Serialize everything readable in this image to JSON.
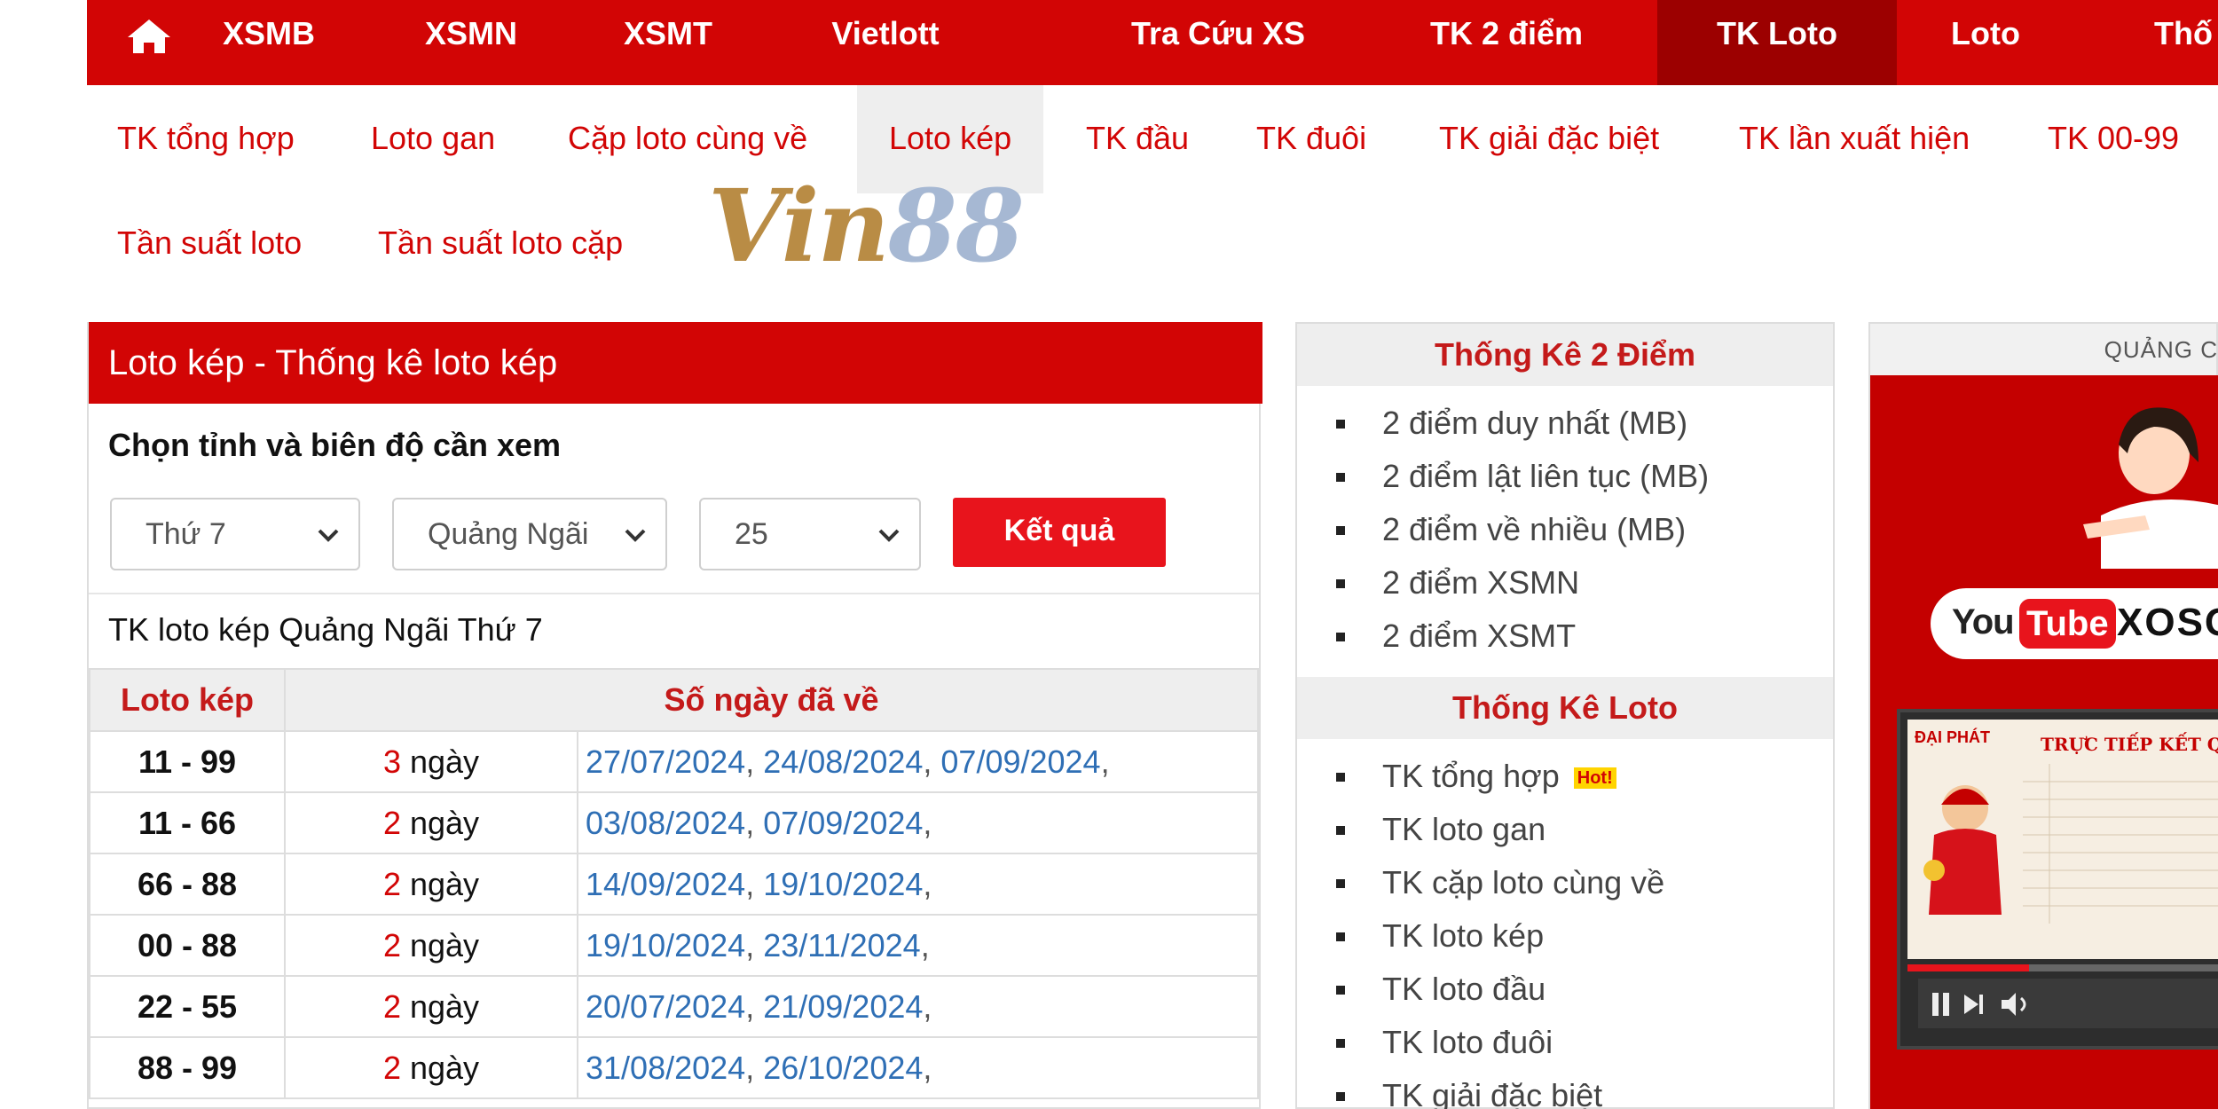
{
  "topnav": {
    "home_icon": "home-icon",
    "items": [
      {
        "label": "XSMB"
      },
      {
        "label": "XSMN"
      },
      {
        "label": "XSMT"
      },
      {
        "label": "Vietlott"
      },
      {
        "label": "Tra Cứu XS"
      },
      {
        "label": "TK 2 điểm"
      },
      {
        "label": "TK Loto",
        "active": true
      },
      {
        "label": "Loto"
      },
      {
        "label": "Thố"
      }
    ]
  },
  "subnav": {
    "items": [
      {
        "label": "TK tổng hợp"
      },
      {
        "label": "Loto gan"
      },
      {
        "label": "Cặp loto cùng về"
      },
      {
        "label": "Loto kép",
        "active": true
      },
      {
        "label": "TK đầu"
      },
      {
        "label": "TK đuôi"
      },
      {
        "label": "TK giải đặc biệt"
      },
      {
        "label": "TK lần xuất hiện"
      },
      {
        "label": "TK 00-99"
      },
      {
        "label": "Tần suất loto"
      },
      {
        "label": "Tần suất loto cặp"
      }
    ]
  },
  "logo": {
    "part1": "Vin",
    "part2": "88"
  },
  "main": {
    "title": "Loto kép - Thống kê loto kép",
    "choose_label": "Chọn tỉnh và biên độ cần xem",
    "selects": {
      "day": "Thứ 7",
      "province": "Quảng Ngãi",
      "range": "25"
    },
    "submit_label": "Kết quả",
    "result_title": "TK loto kép Quảng Ngãi Thứ 7",
    "table": {
      "headers": [
        "Loto kép",
        "Số ngày đã về"
      ],
      "day_unit": "ngày",
      "rows": [
        {
          "pair": "11 - 99",
          "count": "3",
          "dates": [
            "27/07/2024",
            "24/08/2024",
            "07/09/2024"
          ]
        },
        {
          "pair": "11 - 66",
          "count": "2",
          "dates": [
            "03/08/2024",
            "07/09/2024"
          ]
        },
        {
          "pair": "66 - 88",
          "count": "2",
          "dates": [
            "14/09/2024",
            "19/10/2024"
          ]
        },
        {
          "pair": "00 - 88",
          "count": "2",
          "dates": [
            "19/10/2024",
            "23/11/2024"
          ]
        },
        {
          "pair": "22 - 55",
          "count": "2",
          "dates": [
            "20/07/2024",
            "21/09/2024"
          ]
        },
        {
          "pair": "88 - 99",
          "count": "2",
          "dates": [
            "31/08/2024",
            "26/10/2024"
          ]
        }
      ]
    }
  },
  "sidebar": {
    "section1": {
      "title": "Thống Kê 2 Điểm",
      "items": [
        "2 điểm duy nhất (MB)",
        "2 điểm lật liên tục (MB)",
        "2 điểm về nhiều (MB)",
        "2 điểm XSMN",
        "2 điểm XSMT"
      ]
    },
    "section2": {
      "title": "Thống Kê Loto",
      "items": [
        "TK tổng hợp",
        "TK loto gan",
        "TK cặp loto cùng về",
        "TK loto kép",
        "TK loto đầu",
        "TK loto đuôi",
        "TK giải đặc biệt"
      ],
      "hot_label": "Hot!"
    }
  },
  "ad": {
    "label": "QUẢNG C",
    "yt_you": "You",
    "yt_tube": "Tube",
    "channel": "XOSO",
    "brand": "ĐẠI PHÁT",
    "live": "TRỰC TIẾP KẾT QU",
    "progress": 0.37,
    "colors": {
      "bg": "#c40000",
      "accent": "#e8141c"
    }
  },
  "colors": {
    "brand_red": "#d20505",
    "active_red": "#9c0000",
    "link_blue": "#2f6fb5"
  }
}
